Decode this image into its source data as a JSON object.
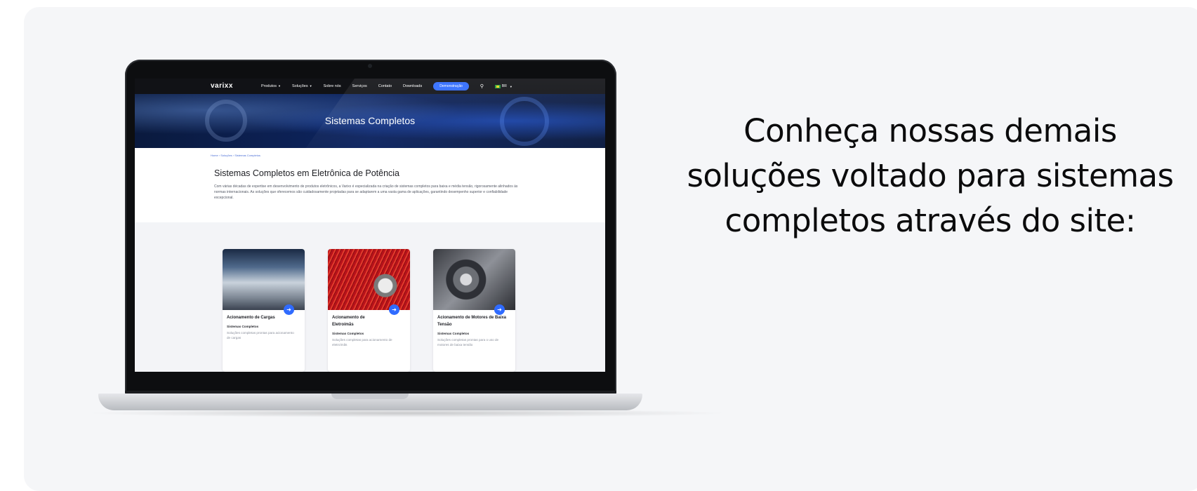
{
  "headline": {
    "line1": "Conheça nossas demais",
    "line2": "soluções voltado para sistemas",
    "line3": "completos através do site:"
  },
  "site": {
    "logo": "varixx",
    "nav": {
      "produtos": "Produtos",
      "solucoes": "Soluções",
      "sobre": "Sobre nós",
      "servicos": "Serviços",
      "contato": "Contato",
      "downloads": "Downloads",
      "demo": "Demonstração",
      "lang": "BR"
    },
    "hero_title": "Sistemas Completos",
    "breadcrumb": "Home › Soluções › Sistemas Completos",
    "page_title": "Sistemas Completos em Eletrônica de Potência",
    "intro": "Com várias décadas de expertise em desenvolvimento de produtos eletrônicos, a Varixx é especializada na criação de sistemas completos para baixa e média tensão, rigorosamente alinhados às normas internacionais. As soluções que oferecemos são cuidadosamente projetadas para se adaptarem a uma vasta gama de aplicações, garantindo desempenho superior e confiabilidade excepcional.",
    "cards": [
      {
        "title": "Acionamento de Cargas",
        "category": "Sistemas Completos",
        "desc": "Soluções completas prontas para acionamento de cargas"
      },
      {
        "title": "Acionamento de Eletroímãs",
        "category": "Sistemas Completos",
        "desc": "Soluções completas para acionamento de eletroímãs"
      },
      {
        "title": "Acionamento de Motores de Baixa Tensão",
        "category": "Sistemas Completos",
        "desc": "Soluções completas prontas para o uso de motores de baixa tensão"
      }
    ]
  },
  "colors": {
    "accent": "#2f6bff",
    "nav_bg": "#111216",
    "panel_bg": "#f5f6f8"
  }
}
